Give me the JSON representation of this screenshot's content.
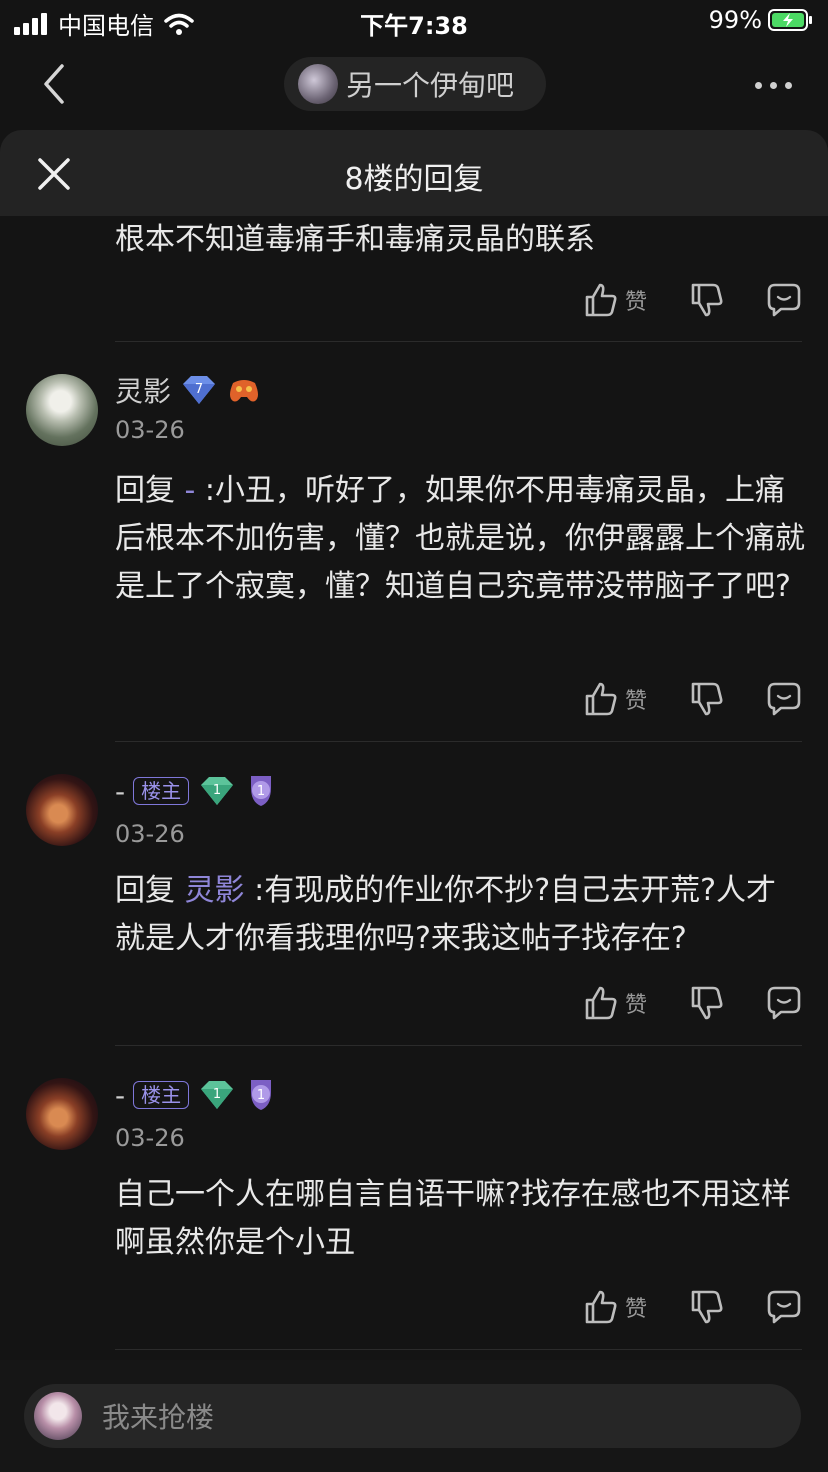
{
  "status": {
    "carrier": "中国电信",
    "time": "下午7:38",
    "battery": "99%"
  },
  "nav": {
    "forum_name": "另一个伊甸吧",
    "back_icon": "chevron-left-icon",
    "more_icon": "more-dots-icon"
  },
  "sheet": {
    "title": "8楼的回复",
    "close_icon": "close-icon"
  },
  "actions": {
    "like": "赞"
  },
  "items": [
    {
      "text": "根本不知道毒痛手和毒痛灵晶的联系"
    },
    {
      "user": "灵影",
      "badges": [
        "diamond-level-7-icon",
        "gamepad-badge-icon"
      ],
      "level": "7",
      "date": "03-26",
      "reply_prefix": "回复",
      "reply_target": "-",
      "text": ":小丑，听好了，如果你不用毒痛灵晶，上痛后根本不加伤害，懂？也就是说，你伊露露上个痛就是上了个寂寞，懂？知道自己究竟带没带脑子了吧?"
    },
    {
      "user": "-",
      "host_badge": "楼主",
      "badges": [
        "diamond-level-1-icon",
        "medal-1-icon"
      ],
      "level": "1",
      "date": "03-26",
      "reply_prefix": "回复",
      "reply_target": "灵影",
      "text": ":有现成的作业你不抄?自己去开荒?人才就是人才你看我理你吗?来我这帖子找存在?"
    },
    {
      "user": "-",
      "host_badge": "楼主",
      "badges": [
        "diamond-level-1-icon",
        "medal-1-icon"
      ],
      "level": "1",
      "date": "03-26",
      "text": "自己一个人在哪自言自语干嘛?找存在感也不用这样啊虽然你是个小丑"
    }
  ],
  "input": {
    "placeholder": "我来抢楼"
  }
}
